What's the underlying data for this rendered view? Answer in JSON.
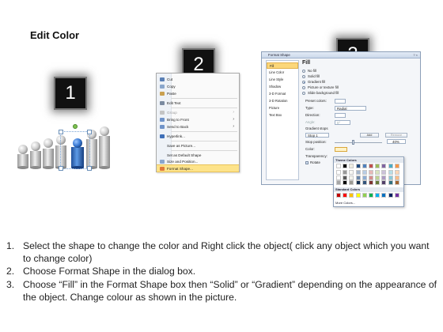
{
  "title": "Edit Color",
  "steps": {
    "one": "1",
    "two": "2",
    "three": "3"
  },
  "context_menu": {
    "items": [
      {
        "label": "Cut",
        "enabled": true,
        "submenu": false
      },
      {
        "label": "Copy",
        "enabled": true,
        "submenu": false
      },
      {
        "label": "Paste",
        "enabled": true,
        "submenu": false
      },
      {
        "label": "Edit Text",
        "enabled": true,
        "submenu": false
      },
      {
        "label": "Group",
        "enabled": false,
        "submenu": true
      },
      {
        "label": "Bring to Front",
        "enabled": true,
        "submenu": true
      },
      {
        "label": "Send to Back",
        "enabled": true,
        "submenu": true
      },
      {
        "label": "Hyperlink...",
        "enabled": true,
        "submenu": false
      },
      {
        "label": "Save as Picture...",
        "enabled": true,
        "submenu": false
      },
      {
        "label": "Set as Default Shape",
        "enabled": true,
        "submenu": false
      },
      {
        "label": "Size and Position...",
        "enabled": true,
        "submenu": false
      },
      {
        "label": "Format Shape...",
        "enabled": true,
        "submenu": false,
        "highlighted": true
      }
    ]
  },
  "format_shape": {
    "title": "Format Shape",
    "window_buttons": "? ×",
    "nav": [
      "Fill",
      "Line Color",
      "Line Style",
      "Shadow",
      "3-D Format",
      "3-D Rotation",
      "Picture",
      "Text Box"
    ],
    "selected_nav": "Fill",
    "heading": "Fill",
    "options": [
      "No fill",
      "Solid fill",
      "Gradient fill",
      "Picture or texture fill",
      "Slide background fill"
    ],
    "selected_option": "Gradient fill",
    "preset_colors": "Preset colors:",
    "type": "Type:",
    "type_value": "Radial",
    "direction": "Direction:",
    "angle": "Angle:",
    "angle_value": "0°",
    "gradient_stops": "Gradient stops",
    "stop_value": "Stop 1",
    "add_button": "Add",
    "remove_button": "Remove",
    "stop_position": "Stop position:",
    "stop_position_value": "40%",
    "color": "Color:",
    "transparency": "Transparency:",
    "rotate": "Rotate"
  },
  "palette": {
    "theme_header": "Theme Colors",
    "standard_header": "Standard Colors",
    "more": "More Colors...",
    "theme_row": [
      "#ffffff",
      "#000000",
      "#eeece1",
      "#1f497d",
      "#4f81bd",
      "#c0504d",
      "#9bbb59",
      "#8064a2",
      "#4bacc6",
      "#f79646"
    ],
    "standard_row": [
      "#c00000",
      "#ff0000",
      "#ffc000",
      "#ffff00",
      "#92d050",
      "#00b050",
      "#00b0f0",
      "#0070c0",
      "#002060",
      "#7030a0"
    ]
  },
  "instructions": [
    {
      "num": "1.",
      "text": "Select the shape to change the color and Right click the object( click any object which you want to change color)"
    },
    {
      "num": "2.",
      "text": "Choose Format Shape in the dialog box."
    },
    {
      "num": "3.",
      "text": "Choose “Fill” in the Format Shape box then “Solid” or “Gradient” depending on the appearance of the object. Change colour as shown in the picture."
    }
  ],
  "colors": {
    "accent_blue": "#2d6bc9",
    "highlight": "#fde38a",
    "badge": "#111111"
  }
}
